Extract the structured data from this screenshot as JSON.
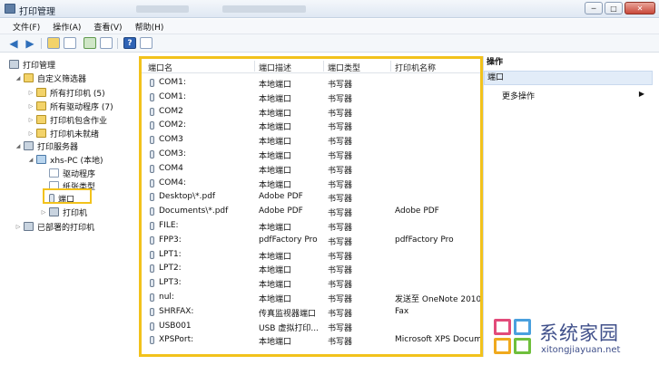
{
  "window": {
    "title": "打印管理",
    "buttons": {
      "minimize": "─",
      "maximize": "□",
      "close": "✕"
    }
  },
  "menu": [
    "文件(F)",
    "操作(A)",
    "查看(V)",
    "帮助(H)"
  ],
  "toolbar": {
    "back_icon": "◀",
    "forward_icon": "▶",
    "help_icon": "?"
  },
  "tree": {
    "root": "打印管理",
    "custom_filters": "自定义筛选器",
    "all_printers": "所有打印机 (5)",
    "all_drivers": "所有驱动程序 (7)",
    "printers_with_jobs": "打印机包含作业",
    "printers_not_ready": "打印机未就绪",
    "print_servers": "打印服务器",
    "server": "xhs-PC (本地)",
    "drivers": "驱动程序",
    "forms": "纸张类型",
    "ports": "端口",
    "printers": "打印机",
    "deployed_printers": "已部署的打印机"
  },
  "list": {
    "columns": [
      "端口名",
      "端口描述",
      "端口类型",
      "打印机名称"
    ],
    "rows": [
      [
        "COM1:",
        "本地端口",
        "书写器",
        ""
      ],
      [
        "COM1:",
        "本地端口",
        "书写器",
        ""
      ],
      [
        "COM2",
        "本地端口",
        "书写器",
        ""
      ],
      [
        "COM2:",
        "本地端口",
        "书写器",
        ""
      ],
      [
        "COM3",
        "本地端口",
        "书写器",
        ""
      ],
      [
        "COM3:",
        "本地端口",
        "书写器",
        ""
      ],
      [
        "COM4",
        "本地端口",
        "书写器",
        ""
      ],
      [
        "COM4:",
        "本地端口",
        "书写器",
        ""
      ],
      [
        "Desktop\\*.pdf",
        "Adobe PDF",
        "书写器",
        ""
      ],
      [
        "Documents\\*.pdf",
        "Adobe PDF",
        "书写器",
        "Adobe PDF"
      ],
      [
        "FILE:",
        "本地端口",
        "书写器",
        ""
      ],
      [
        "FPP3:",
        "pdfFactory Pro",
        "书写器",
        "pdfFactory Pro"
      ],
      [
        "LPT1:",
        "本地端口",
        "书写器",
        ""
      ],
      [
        "LPT2:",
        "本地端口",
        "书写器",
        ""
      ],
      [
        "LPT3:",
        "本地端口",
        "书写器",
        ""
      ],
      [
        "nul:",
        "本地端口",
        "书写器",
        "发送至 OneNote 2010"
      ],
      [
        "SHRFAX:",
        "传真监视器端口",
        "书写器",
        "Fax"
      ],
      [
        "USB001",
        "USB 虚拟打印...",
        "书写器",
        ""
      ],
      [
        "XPSPort:",
        "本地端口",
        "书写器",
        "Microsoft XPS Document Writer"
      ]
    ]
  },
  "actions": {
    "header": "操作",
    "selected": "端口",
    "more": "更多操作",
    "more_arrow": "▶"
  },
  "watermark": {
    "name": "系统家园",
    "url": "xitongjiayuan.net"
  }
}
